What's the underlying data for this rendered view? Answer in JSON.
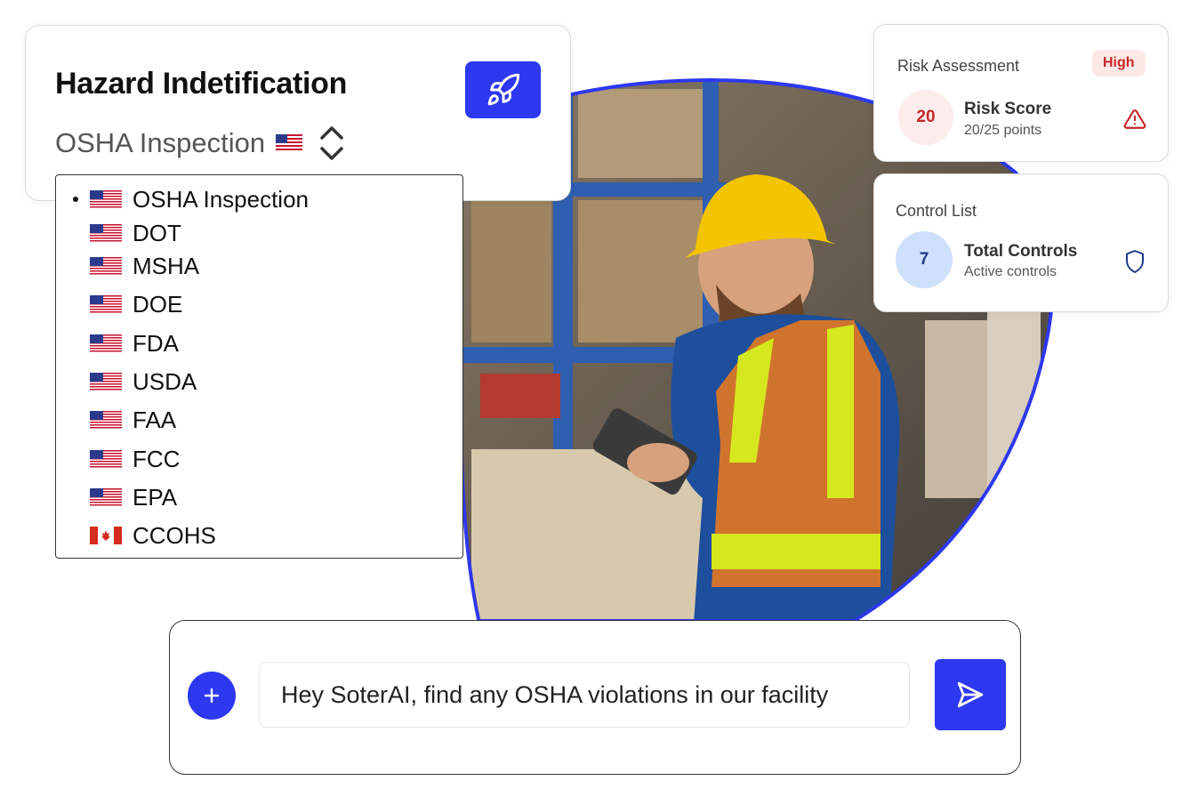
{
  "hazard": {
    "title": "Hazard Indetification",
    "selected_value": "OSHA Inspection",
    "options": [
      {
        "label": "OSHA Inspection",
        "flag": "us",
        "selected": true
      },
      {
        "label": "DOT",
        "flag": "us"
      },
      {
        "label": "MSHA",
        "flag": "us"
      },
      {
        "label": "DOE",
        "flag": "us"
      },
      {
        "label": "FDA",
        "flag": "us"
      },
      {
        "label": "USDA",
        "flag": "us"
      },
      {
        "label": "FAA",
        "flag": "us"
      },
      {
        "label": "FCC",
        "flag": "us"
      },
      {
        "label": "EPA",
        "flag": "us"
      },
      {
        "label": "CCOHS",
        "flag": "ca"
      }
    ],
    "button_icon": "rocket-icon"
  },
  "risk": {
    "label": "Risk Assessment",
    "badge": "High",
    "score": "20",
    "score_title": "Risk Score",
    "score_sub": "20/25 points",
    "icon": "warning-icon"
  },
  "control": {
    "label": "Control List",
    "count": "7",
    "title": "Total Controls",
    "sub": "Active controls",
    "icon": "shield-icon"
  },
  "chat": {
    "prompt": "Hey SoterAI, find any OSHA violations in our facility",
    "plus_icon": "plus-icon",
    "send_icon": "send-icon"
  },
  "colors": {
    "accent": "#2d38f0",
    "danger": "#c62828",
    "danger_bg": "#fdecec",
    "info_bg": "#cfe0fb"
  }
}
